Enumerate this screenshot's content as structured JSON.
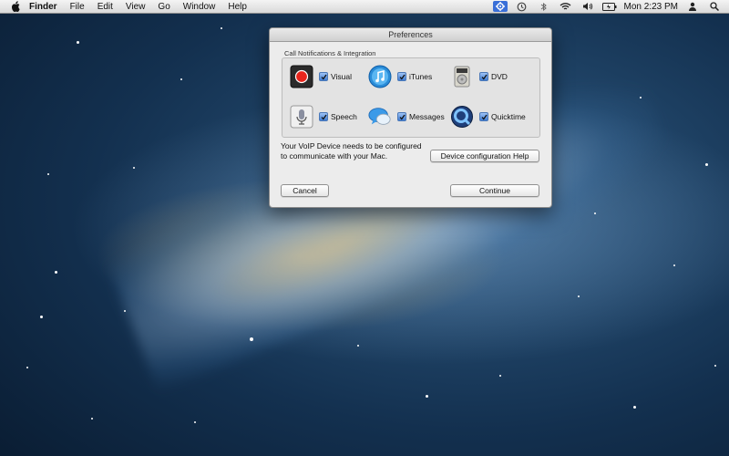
{
  "menubar": {
    "apple_icon": "apple-logo-icon",
    "app_name": "Finder",
    "menus": [
      "File",
      "Edit",
      "View",
      "Go",
      "Window",
      "Help"
    ],
    "status_icons": [
      "status-app-icon",
      "time-machine-icon",
      "bluetooth-icon",
      "wifi-icon",
      "volume-icon",
      "battery-icon"
    ],
    "clock": "Mon 2:23 PM",
    "right_icons": [
      "user-icon",
      "spotlight-icon"
    ]
  },
  "window": {
    "title": "Preferences",
    "group_label": "Call Notifications & Integration",
    "options": [
      {
        "label": "Visual",
        "checked": true,
        "icon": "record-icon"
      },
      {
        "label": "iTunes",
        "checked": true,
        "icon": "itunes-icon"
      },
      {
        "label": "DVD",
        "checked": true,
        "icon": "dvd-player-icon"
      },
      {
        "label": "Speech",
        "checked": true,
        "icon": "microphone-icon"
      },
      {
        "label": "Messages",
        "checked": true,
        "icon": "messages-icon"
      },
      {
        "label": "Quicktime",
        "checked": true,
        "icon": "quicktime-icon"
      }
    ],
    "message": "Your VoIP Device needs to be configured to communicate with your Mac.",
    "help_button": "Device configuration Help",
    "cancel_button": "Cancel",
    "continue_button": "Continue"
  },
  "colors": {
    "accent": "#3a6fd8",
    "checkbox": "#3f7cd2",
    "window_bg": "#ececec"
  }
}
